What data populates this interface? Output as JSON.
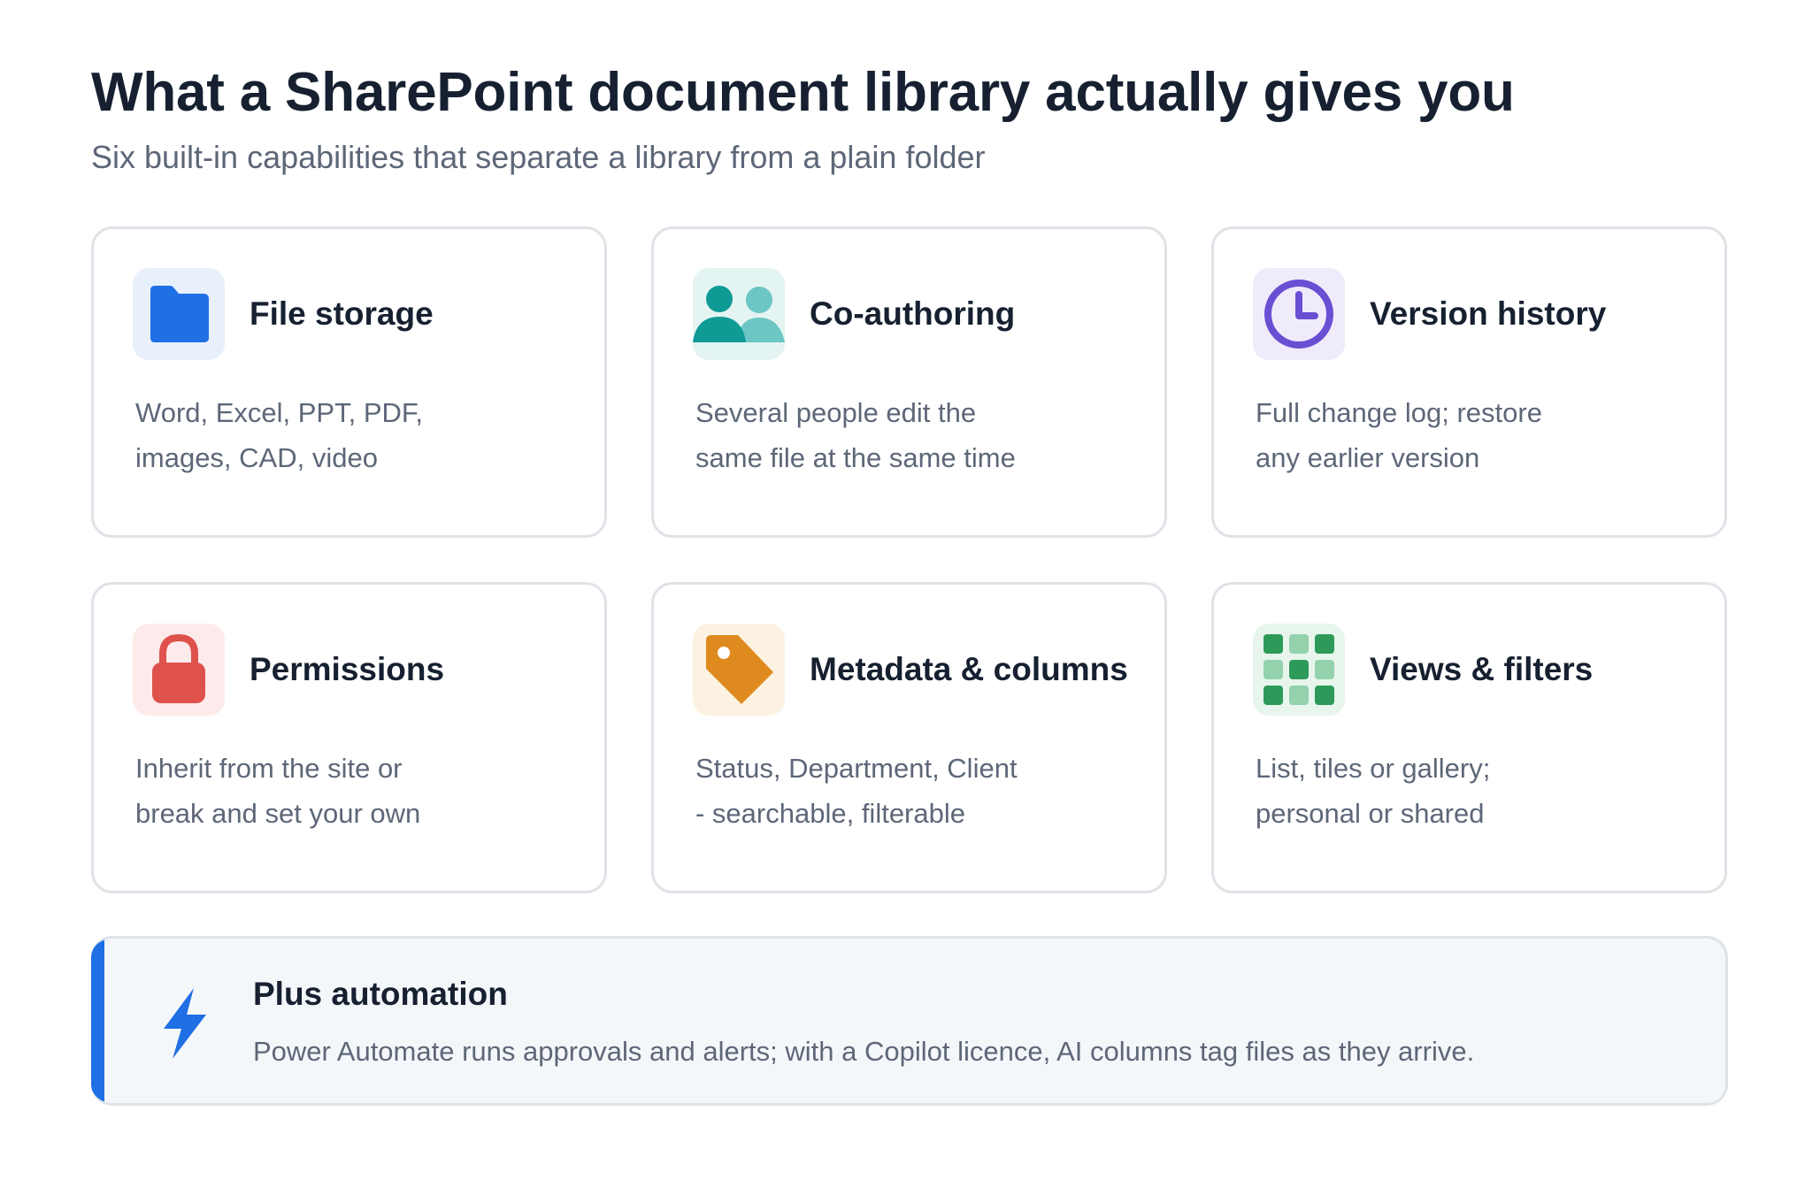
{
  "header": {
    "title": "What a SharePoint document library actually gives you",
    "subtitle": "Six built-in capabilities that separate a library from a plain folder"
  },
  "cards": [
    {
      "icon": "folder-icon",
      "title": "File storage",
      "desc_line1": "Word, Excel, PPT, PDF,",
      "desc_line2": "images, CAD, video",
      "accent": "#1f6fe5",
      "tile_bg": "#e8f0fc"
    },
    {
      "icon": "people-icon",
      "title": "Co-authoring",
      "desc_line1": "Several people edit the",
      "desc_line2": "same file at the same time",
      "accent": "#0f9a96",
      "tile_bg": "#e3f4f2"
    },
    {
      "icon": "clock-icon",
      "title": "Version history",
      "desc_line1": "Full change log; restore",
      "desc_line2": "any earlier version",
      "accent": "#6a4fd3",
      "tile_bg": "#efebfb"
    },
    {
      "icon": "lock-icon",
      "title": "Permissions",
      "desc_line1": "Inherit from the site or",
      "desc_line2": "break and set your own",
      "accent": "#de524b",
      "tile_bg": "#fcebea"
    },
    {
      "icon": "tag-icon",
      "title": "Metadata & columns",
      "desc_line1": "Status, Department, Client",
      "desc_line2": "- searchable, filterable",
      "accent": "#de8a1f",
      "tile_bg": "#fdf1e2"
    },
    {
      "icon": "grid-icon",
      "title": "Views & filters",
      "desc_line1": "List, tiles or gallery;",
      "desc_line2": "personal or shared",
      "accent": "#2e9a5a",
      "tile_bg": "#e7f5ec"
    }
  ],
  "callout": {
    "icon": "lightning-icon",
    "title": "Plus automation",
    "text": "Power Automate runs approvals and alerts; with a Copilot licence, AI columns tag files as they arrive.",
    "accent": "#1f6fe5"
  }
}
